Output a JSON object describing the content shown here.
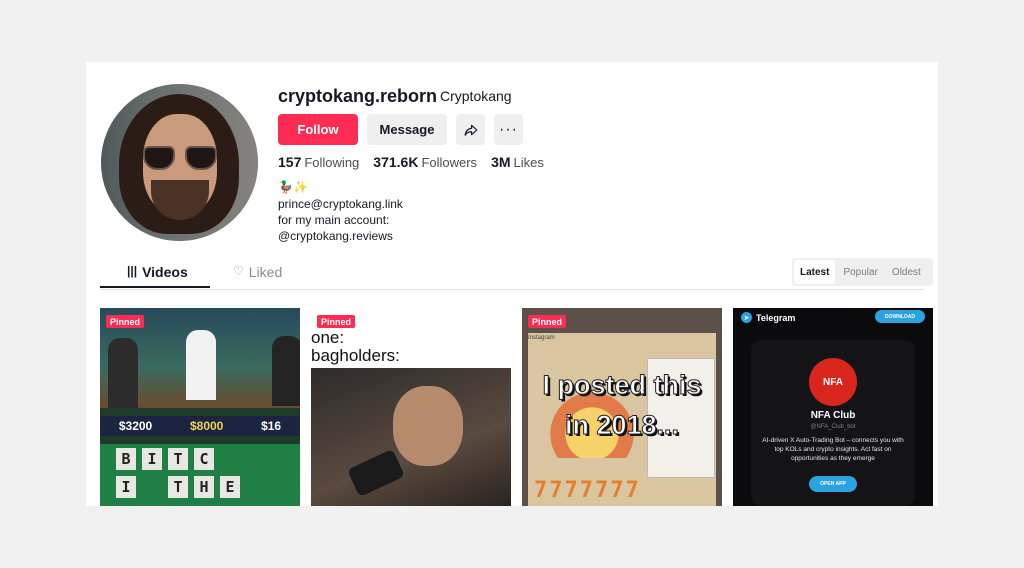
{
  "profile": {
    "username": "cryptokang.reborn",
    "nickname": "Cryptokang",
    "buttons": {
      "follow": "Follow",
      "message": "Message",
      "more": "···"
    },
    "stats": [
      {
        "value": "157",
        "label": "Following"
      },
      {
        "value": "371.6K",
        "label": "Followers"
      },
      {
        "value": "3M",
        "label": "Likes"
      }
    ],
    "bio_emoji": "🦆✨",
    "bio_lines": [
      "prince@cryptokang.link",
      "for my main account:",
      "@cryptokang.reviews"
    ]
  },
  "tabs": {
    "videos": "Videos",
    "liked": "Liked"
  },
  "sort": {
    "latest": "Latest",
    "popular": "Popular",
    "oldest": "Oldest"
  },
  "videos": {
    "pinned_label": "Pinned",
    "v1": {
      "prize_left": "$3200",
      "prize_center": "$8000",
      "prize_right": "$16",
      "tiles": [
        "B",
        "I",
        "T",
        "C",
        "I",
        "T",
        "H",
        "E"
      ]
    },
    "v2": {
      "line1": "one:",
      "line2": "bagholders:"
    },
    "v3": {
      "line1": "I posted this",
      "line2": "in 2018...",
      "numbers": "7777777",
      "insta": "Instagram"
    },
    "v4": {
      "app": "Telegram",
      "download": "DOWNLOAD",
      "logo": "NFA",
      "name": "NFA Club",
      "handle": "@NFA_Club_bot",
      "desc": "AI-driven X Auto-Trading Bot – connects you with top KOLs and crypto insights. Act fast on opportunities as they emerge",
      "open": "OPEN APP"
    }
  },
  "colors": {
    "accent": "#fe2c55",
    "telegram": "#2aa3e0"
  }
}
